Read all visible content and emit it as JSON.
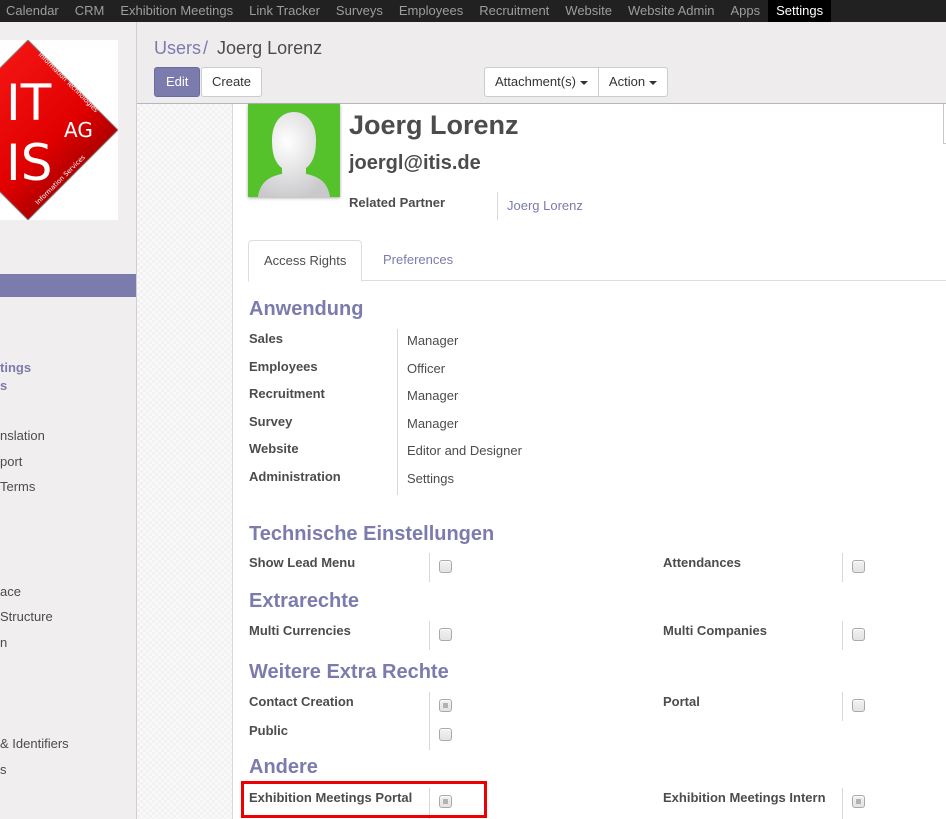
{
  "topnav": {
    "items": [
      {
        "label": "Calendar",
        "active": false
      },
      {
        "label": "CRM",
        "active": false
      },
      {
        "label": "Exhibition Meetings",
        "active": false
      },
      {
        "label": "Link Tracker",
        "active": false
      },
      {
        "label": "Surveys",
        "active": false
      },
      {
        "label": "Employees",
        "active": false
      },
      {
        "label": "Recruitment",
        "active": false
      },
      {
        "label": "Website",
        "active": false
      },
      {
        "label": "Website Admin",
        "active": false
      },
      {
        "label": "Apps",
        "active": false
      },
      {
        "label": "Settings",
        "active": true
      }
    ]
  },
  "sidebar": {
    "logo": {
      "main_top": "IT",
      "main_bottom": "IS",
      "suffix": "AG",
      "arc_top": "Information Technologies",
      "arc_bottom": "Information Services"
    },
    "items": [
      {
        "label": "tings",
        "active": true
      },
      {
        "label": "s",
        "active": true
      },
      {
        "label": "nslation",
        "active": false
      },
      {
        "label": "port",
        "active": false
      },
      {
        "label": " Terms",
        "active": false
      },
      {
        "label": "ace",
        "active": false
      },
      {
        "label": "Structure",
        "active": false
      },
      {
        "label": "n",
        "active": false
      },
      {
        "label": " & Identifiers",
        "active": false
      },
      {
        "label": "s",
        "active": false
      }
    ]
  },
  "breadcrumb": {
    "parent": "Users",
    "separator": "/",
    "current": "Joerg Lorenz"
  },
  "toolbar": {
    "edit_label": "Edit",
    "create_label": "Create",
    "attachments_label": "Attachment(s)",
    "action_label": "Action"
  },
  "user": {
    "name": "Joerg Lorenz",
    "email": "joergl@itis.de",
    "related_partner_label": "Related Partner",
    "related_partner_value": "Joerg Lorenz"
  },
  "tabs": [
    {
      "label": "Access Rights",
      "active": true
    },
    {
      "label": "Preferences",
      "active": false
    }
  ],
  "sections": {
    "anwendung": {
      "title": "Anwendung",
      "fields": [
        {
          "label": "Sales",
          "value": "Manager"
        },
        {
          "label": "Employees",
          "value": "Officer"
        },
        {
          "label": "Recruitment",
          "value": "Manager"
        },
        {
          "label": "Survey",
          "value": "Manager"
        },
        {
          "label": "Website",
          "value": "Editor and Designer"
        },
        {
          "label": "Administration",
          "value": "Settings"
        }
      ]
    },
    "technische": {
      "title": "Technische Einstellungen",
      "fields": [
        {
          "label": "Show Lead Menu",
          "checked": false
        },
        {
          "label": "Attendances",
          "checked": false
        }
      ]
    },
    "extrarechte": {
      "title": "Extrarechte",
      "fields": [
        {
          "label": "Multi Currencies",
          "checked": false
        },
        {
          "label": "Multi Companies",
          "checked": false
        }
      ]
    },
    "weitere": {
      "title": "Weitere Extra Rechte",
      "fields": [
        {
          "label": "Contact Creation",
          "checked": true
        },
        {
          "label": "Portal",
          "checked": false
        },
        {
          "label": "Public",
          "checked": false
        }
      ]
    },
    "andere": {
      "title": "Andere",
      "fields": [
        {
          "label": "Exhibition Meetings Portal",
          "checked": true,
          "highlighted": true
        },
        {
          "label": "Exhibition Meetings Intern",
          "checked": true
        }
      ]
    }
  },
  "colors": {
    "accent": "#7c7bad",
    "topbar": "#212121",
    "avatar_bg": "#55c22b",
    "highlight": "#ef0000",
    "logo_red": "#e30000"
  }
}
